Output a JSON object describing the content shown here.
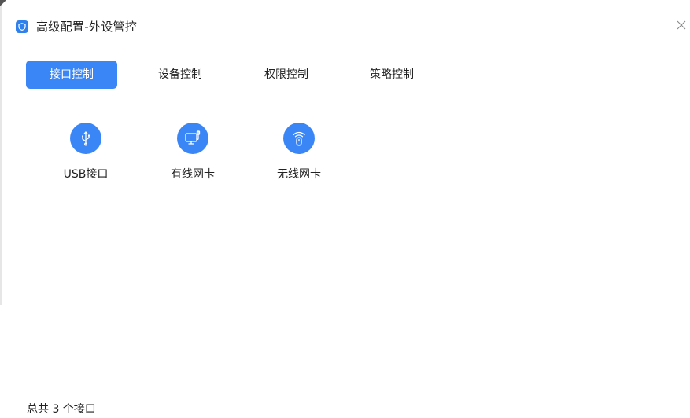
{
  "window": {
    "title": "高级配置-外设管控",
    "close_symbol": "×"
  },
  "tabs": [
    {
      "label": "接口控制",
      "active": true
    },
    {
      "label": "设备控制",
      "active": false
    },
    {
      "label": "权限控制",
      "active": false
    },
    {
      "label": "策略控制",
      "active": false
    }
  ],
  "interfaces": [
    {
      "label": "USB接口",
      "icon": "usb-icon"
    },
    {
      "label": "有线网卡",
      "icon": "wired-network-card-icon"
    },
    {
      "label": "无线网卡",
      "icon": "wireless-network-card-icon"
    }
  ],
  "footer": {
    "summary": "总共 3 个接口"
  },
  "colors": {
    "accent": "#3a86f7",
    "text": "#222222",
    "background": "#ffffff"
  }
}
